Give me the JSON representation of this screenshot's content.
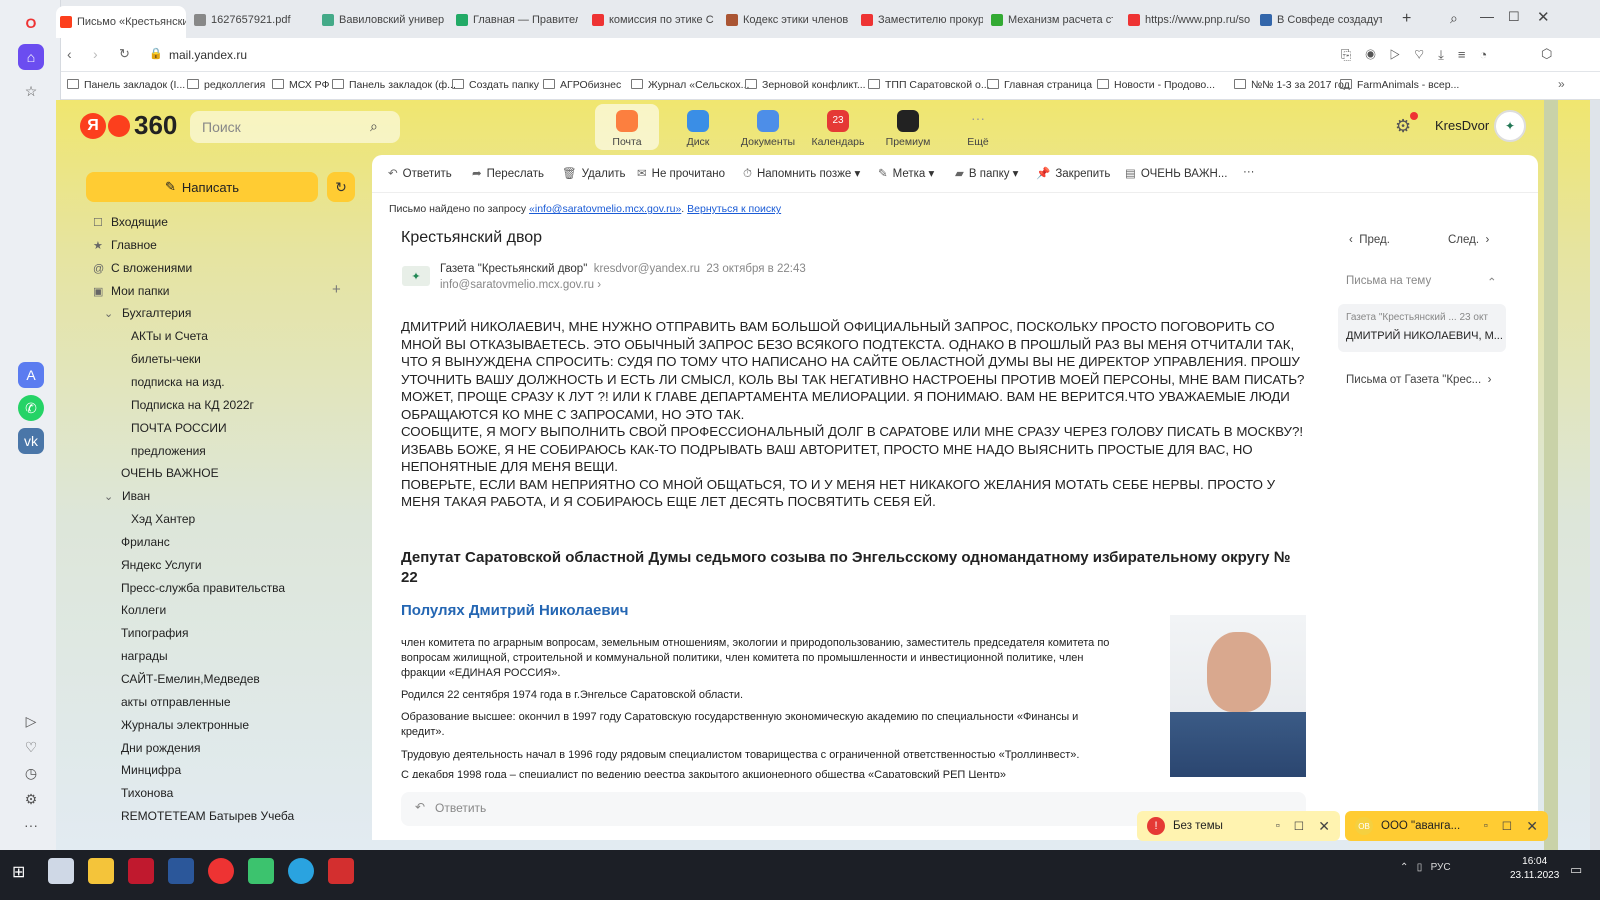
{
  "browser": {
    "tabs": [
      {
        "label": "Письмо «Крестьянский д",
        "color": "#fc3f1d"
      },
      {
        "label": "1627657921.pdf",
        "color": "#888"
      },
      {
        "label": "Вавиловский университ",
        "color": "#4a8"
      },
      {
        "label": "Главная — Правительс",
        "color": "#2a6"
      },
      {
        "label": "комиссия по этике Сар",
        "color": "#e33"
      },
      {
        "label": "Кодекс этики членов С",
        "color": "#a53"
      },
      {
        "label": "Заместителю прокурор",
        "color": "#e33"
      },
      {
        "label": "Механизм расчета сто",
        "color": "#3a3"
      },
      {
        "label": "https://www.pnp.ru/soc",
        "color": "#e33"
      },
      {
        "label": "В Совфеде создадут эф",
        "color": "#36a"
      }
    ],
    "url": "mail.yandex.ru",
    "bookmarks": [
      "Панель закладок (I...",
      "редколлегия",
      "МСХ РФ",
      "Панель закладок (ф...",
      "Создать папку",
      "АГРОбизнес",
      "Журнал «Сельскох...",
      "Зерновой конфликт...",
      "ТПП Саратовской о...",
      "Главная страница",
      "Новости - Продово...",
      "№№ 1-3 за 2017 год",
      "FarmAnimals - всер..."
    ]
  },
  "header": {
    "logo_ya": "Я",
    "logo_num": "360",
    "search_placeholder": "Поиск",
    "services": [
      {
        "label": "Почта",
        "color": "#fc7f3f"
      },
      {
        "label": "Диск",
        "color": "#3a8ee6"
      },
      {
        "label": "Документы",
        "color": "#4d8ee8"
      },
      {
        "label": "Календарь",
        "color": "#e53935",
        "badge": "23"
      },
      {
        "label": "Премиум",
        "color": "#222"
      },
      {
        "label": "Ещё",
        "color": "#999"
      }
    ],
    "username": "KresDvor"
  },
  "sidebar": {
    "compose": "Написать",
    "folders": [
      {
        "label": "Входящие",
        "indent": 0,
        "icon": "☐"
      },
      {
        "label": "Главное",
        "indent": 0,
        "icon": "★"
      },
      {
        "label": "С вложениями",
        "indent": 0,
        "icon": "@"
      },
      {
        "label": "Мои папки",
        "indent": 0,
        "icon": "▣"
      },
      {
        "label": "Бухгалтерия",
        "indent": 1,
        "icon": "⌄"
      },
      {
        "label": "АКТы и Счета",
        "indent": 2,
        "icon": ""
      },
      {
        "label": "билеты-чеки",
        "indent": 2,
        "icon": ""
      },
      {
        "label": "подписка на изд.",
        "indent": 2,
        "icon": ""
      },
      {
        "label": "Подписка на КД 2022г",
        "indent": 2,
        "icon": ""
      },
      {
        "label": "ПОЧТА РОССИИ",
        "indent": 2,
        "icon": ""
      },
      {
        "label": "предложения",
        "indent": 2,
        "icon": ""
      },
      {
        "label": "ОЧЕНЬ ВАЖНОЕ",
        "indent": 1,
        "icon": ""
      },
      {
        "label": "Иван",
        "indent": 1,
        "icon": "⌄"
      },
      {
        "label": "Хэд Хантер",
        "indent": 2,
        "icon": ""
      },
      {
        "label": "Фриланс",
        "indent": 1,
        "icon": ""
      },
      {
        "label": "Яндекс Услуги",
        "indent": 1,
        "icon": ""
      },
      {
        "label": "Пресс-служба правительства",
        "indent": 1,
        "icon": ""
      },
      {
        "label": "Коллеги",
        "indent": 1,
        "icon": ""
      },
      {
        "label": "Типография",
        "indent": 1,
        "icon": ""
      },
      {
        "label": "награды",
        "indent": 1,
        "icon": ""
      },
      {
        "label": "САЙТ-Емелин,Медведев",
        "indent": 1,
        "icon": ""
      },
      {
        "label": "акты отправленные",
        "indent": 1,
        "icon": ""
      },
      {
        "label": "Журналы электронные",
        "indent": 1,
        "icon": ""
      },
      {
        "label": "Дни рождения",
        "indent": 1,
        "icon": ""
      },
      {
        "label": "Минцифра",
        "indent": 1,
        "icon": ""
      },
      {
        "label": "Тихонова",
        "indent": 1,
        "icon": ""
      },
      {
        "label": "REMOTETEAM Батырев Учеба",
        "indent": 1,
        "icon": ""
      }
    ]
  },
  "toolbar": [
    {
      "label": "Ответить",
      "icon": "↶"
    },
    {
      "label": "Переслать",
      "icon": "➦"
    },
    {
      "label": "Удалить",
      "icon": "🗑"
    },
    {
      "label": "Не прочитано",
      "icon": "✉"
    },
    {
      "label": "Напомнить позже ▾",
      "icon": "⏱"
    },
    {
      "label": "Метка ▾",
      "icon": "✎"
    },
    {
      "label": "В папку ▾",
      "icon": "▰"
    },
    {
      "label": "Закрепить",
      "icon": "📌"
    },
    {
      "label": "ОЧЕНЬ ВАЖН...",
      "icon": "▤"
    },
    {
      "label": "···",
      "icon": ""
    }
  ],
  "notice": {
    "prefix": "Письмо найдено по запросу ",
    "query": "«info@saratovmelio.mcx.gov.ru»",
    "sep": ". ",
    "back": "Вернуться к поиску"
  },
  "message": {
    "subject": "Крестьянский двор",
    "sender_name": "Газета \"Крестьянский двор\"",
    "sender_email": "kresdvor@yandex.ru",
    "date": "23 октября в 22:43",
    "to": "info@saratovmelio.mcx.gov.ru",
    "paragraphs": [
      "ДМИТРИЙ НИКОЛАЕВИЧ, МНЕ НУЖНО ОТПРАВИТЬ ВАМ БОЛЬШОЙ ОФИЦИАЛЬНЫЙ ЗАПРОС, ПОСКОЛЬКУ ПРОСТО ПОГОВОРИТЬ СО МНОЙ ВЫ ОТКАЗЫВАЕТЕСЬ. ЭТО  ОБЫЧНЫЙ ЗАПРОС БЕЗО ВСЯКОГО ПОДТЕКСТА. ОДНАКО В ПРОШЛЫЙ РАЗ ВЫ МЕНЯ ОТЧИТАЛИ ТАК, ЧТО Я ВЫНУЖДЕНА СПРОСИТЬ: СУДЯ ПО ТОМУ  ЧТО НАПИСАНО НА САЙТЕ ОБЛАСТНОЙ ДУМЫ ВЫ НЕ ДИРЕКТОР УПРАВЛЕНИЯ. ПРОШУ УТОЧНИТЬ ВАШУ ДОЛЖНОСТЬ И ЕСТЬ ЛИ СМЫСЛ, КОЛЬ ВЫ ТАК НЕГАТИВНО НАСТРОЕНЫ ПРОТИВ МОЕЙ ПЕРСОНЫ, МНЕ ВАМ ПИСАТЬ? МОЖЕТ, ПРОЩЕ СРАЗУ К ЛУТ ?! ИЛИ К ГЛАВЕ ДЕПАРТАМЕНТА МЕЛИОРАЦИИ. Я ПОНИМАЮ. ВАМ НЕ ВЕРИТСЯ.ЧТО УВАЖАЕМЫЕ ЛЮДИ ОБРАЩАЮТСЯ КО МНЕ С ЗАПРОСАМИ, НО ЭТО ТАК.",
      "СООБЩИТЕ, Я МОГУ ВЫПОЛНИТЬ СВОЙ ПРОФЕССИОНАЛЬНЫЙ ДОЛГ В САРАТОВЕ ИЛИ МНЕ СРАЗУ ЧЕРЕЗ ГОЛОВУ ПИСАТЬ В МОСКВУ?! ИЗБАВЬ БОЖЕ, Я НЕ СОБИРАЮСЬ  КАК-ТО ПОДРЫВАТЬ ВАШ АВТОРИТЕТ, ПРОСТО МНЕ НАДО ВЫЯСНИТЬ ПРОСТЫЕ ДЛЯ ВАС, НО НЕПОНЯТНЫЕ ДЛЯ МЕНЯ ВЕЩИ.",
      "ПОВЕРЬТЕ, ЕСЛИ ВАМ НЕПРИЯТНО СО МНОЙ ОБЩАТЬСЯ, ТО И У МЕНЯ НЕТ НИКАКОГО ЖЕЛАНИЯ МОТАТЬ СЕБЕ НЕРВЫ. ПРОСТО У МЕНЯ ТАКАЯ РАБОТА, И Я СОБИРАЮСЬ ЕЩЕ ЛЕТ ДЕСЯТЬ ПОСВЯТИТЬ СЕБЯ ЕЙ."
    ],
    "deputy_heading": "Депутат Саратовской областной Думы седьмого созыва по Энгельсскому одномандатному избирательному округу № 22",
    "deputy_name": "Полулях Дмитрий Николаевич",
    "bio": [
      "член комитета по аграрным вопросам, земельным отношениям, экологии и природопользованию, заместитель председателя комитета по вопросам жилищной, строительной и коммунальной политики, член комитета по промышленности и инвестиционной политике, член фракции «ЕДИНАЯ РОССИЯ».",
      "Родился 22 сентября 1974 года в г.Энгельсе Саратовской области.",
      "Образование высшее: окончил в 1997 году Саратовскую государственную экономическую академию по специальности «Финансы и кредит».",
      "Трудовую деятельность начал в 1996 году рядовым специалистом товарищества с ограниченной ответственностью «Троллинвест».",
      "С декабря 1998 года – специалист по ведению реестра закрытого акционерного общества «Саратовский РЕП Центр»"
    ],
    "reply": "Ответить"
  },
  "right_panel": {
    "prev": "Пред.",
    "next": "След.",
    "thread_title": "Письма на тему",
    "thread_item_from": "Газета \"Крестьянский ... 23 окт",
    "thread_item_text": "ДМИТРИЙ НИКОЛАЕВИЧ, М...",
    "letters_from": "Письма от Газета \"Крес..."
  },
  "toasts": [
    {
      "label": "Без темы"
    },
    {
      "label": "ООО \"аванга..."
    }
  ],
  "taskbar": {
    "time": "16:04",
    "date": "23.11.2023",
    "lang": "РУС"
  }
}
